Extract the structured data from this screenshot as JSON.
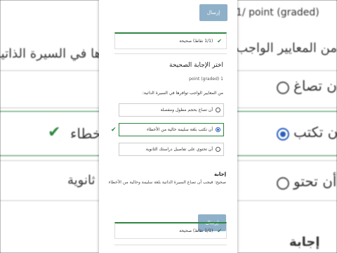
{
  "panel": {
    "submit_label": "إرسال",
    "feedback_top": "(1/1 نقاط) صحيحة",
    "question_title": "اختر الإجابة الصحيحة",
    "points": "1 point (graded)",
    "prompt": "من المعايير الواجب توافرها في السيرة الذاتية:",
    "options": [
      {
        "label": "أن تصاغ بحجم مطول ومفصلة",
        "selected": false
      },
      {
        "label": "أن تكتب بلغة سليمة خالية من الأخطاء",
        "selected": true
      },
      {
        "label": "أن تحتوي على تفاصيل دراستك الثانوية",
        "selected": false
      }
    ],
    "answer_heading": "إجابة",
    "answer_text": "صحيح: فيجب أن تصاغ السيرة الذاتية بلغة سليمة وخالية من الأخطاء",
    "submit_label_2": "إرسال",
    "feedback_bottom": "(1/1 نقاط) صحيحة"
  },
  "background": {
    "points_fragment": "1/ point (graded)",
    "prompt_fragment": "من المعايير الواجب توافرها في السيرة الذاتية",
    "option1_fragment": "أن تصاغ",
    "option2_fragment": "أن تكتب",
    "option2_end": "أخطاء",
    "option3_fragment": "أن تحتو",
    "option3_end": "ثانوية",
    "answer_fragment": "إجابة"
  },
  "colors": {
    "correct": "#2e8540",
    "selected_radio": "#2b5fbf",
    "submit_bg": "#8fb0c9"
  }
}
